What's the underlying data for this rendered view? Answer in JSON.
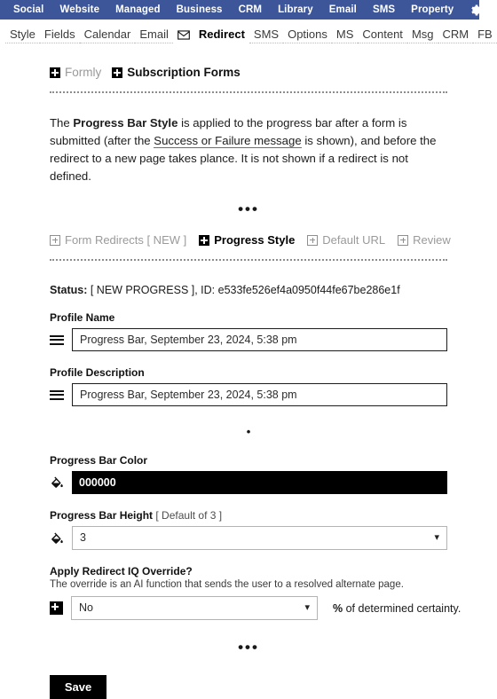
{
  "topbar": {
    "items": [
      {
        "label": "Social"
      },
      {
        "label": "Website"
      },
      {
        "label": "Managed"
      },
      {
        "label": "Business"
      },
      {
        "label": "CRM"
      },
      {
        "label": "Library"
      },
      {
        "label": "Email"
      },
      {
        "label": "SMS"
      },
      {
        "label": "Property"
      }
    ],
    "gear_icon": "gear-icon",
    "background_color": "#3c5699"
  },
  "tabs": [
    {
      "label": "Style",
      "active": false
    },
    {
      "label": "Fields",
      "active": false
    },
    {
      "label": "Calendar",
      "active": false
    },
    {
      "label": "Email",
      "active": false
    },
    {
      "label": "envelope-icon",
      "icon": true
    },
    {
      "label": "Redirect",
      "active": true
    },
    {
      "label": "SMS",
      "active": false
    },
    {
      "label": "Options",
      "active": false
    },
    {
      "label": "MS",
      "active": false
    },
    {
      "label": "Content",
      "active": false
    },
    {
      "label": "Msg",
      "active": false
    },
    {
      "label": "CRM",
      "active": false
    },
    {
      "label": "FB",
      "active": false
    },
    {
      "label": "camera-icon",
      "icon": true
    },
    {
      "label": "list-icon",
      "icon": true
    }
  ],
  "breadcrumb": {
    "items": [
      {
        "label": "Formly",
        "active": false
      },
      {
        "label": "Subscription Forms",
        "active": true
      }
    ]
  },
  "intro": {
    "part1": "The ",
    "bold1": "Progress Bar Style",
    "part2": " is applied to the progress bar after a form is submitted (after the ",
    "link": "Success or Failure message",
    "part3": " is shown), and before the redirect to a new page takes plance. It is not shown if a redirect is not defined."
  },
  "ellipsis_marker": "•••",
  "dot_marker": "•",
  "subnav": {
    "items": [
      {
        "label": "Form Redirects [ NEW ]",
        "active": false
      },
      {
        "label": "Progress Style",
        "active": true
      },
      {
        "label": "Default URL",
        "active": false
      },
      {
        "label": "Review",
        "active": false
      }
    ]
  },
  "status": {
    "label": "Status:",
    "value": " [ NEW PROGRESS ], ID: e533fe526ef4a0950f44fe67be286e1f"
  },
  "fields": {
    "profile_name": {
      "label": "Profile Name",
      "value": "Progress Bar, September 23, 2024, 5:38 pm",
      "placeholder": "Profile Name",
      "icon": "hamburger-icon"
    },
    "profile_description": {
      "label": "Profile Description",
      "value": "Progress Bar, September 23, 2024, 5:38 pm",
      "placeholder": "Profile Description",
      "icon": "hamburger-icon"
    },
    "progress_bar_color": {
      "label": "Progress Bar Color",
      "value": "000000",
      "swatch": "#000000",
      "icon": "paint-bucket-icon"
    },
    "progress_bar_height": {
      "label": "Progress Bar Height",
      "label_suffix": " [ Default of 3 ]",
      "value": "3",
      "icon": "paint-bucket-icon"
    },
    "redirect_iq_override": {
      "label": "Apply Redirect IQ Override?",
      "helper": "The override is an AI function that sends the user to a resolved alternate page.",
      "value": "No",
      "suffix_bold": "%",
      "suffix_rest": " of determined certainty.",
      "icon": "plus-icon"
    }
  },
  "save_button": {
    "label": "Save"
  }
}
